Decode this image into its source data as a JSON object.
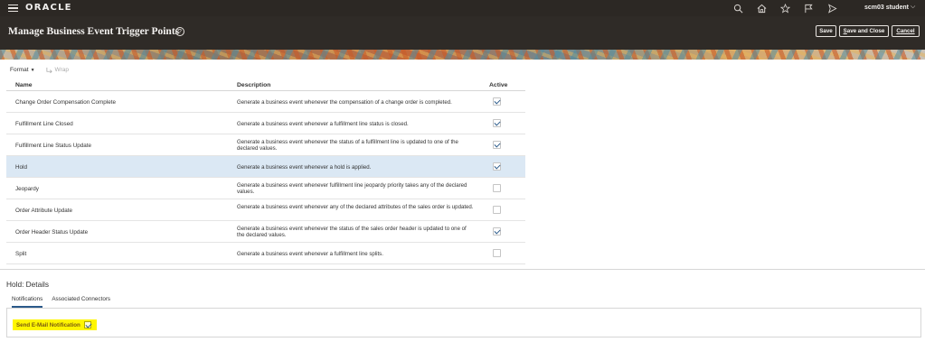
{
  "app": {
    "logo": "ORACLE",
    "user": "scm03 student",
    "user_caret": "⌵"
  },
  "header": {
    "title": "Manage Business Event Trigger Points",
    "help": "?",
    "save_label": "Save",
    "save_close_label_first": "S",
    "save_close_label_rest": "ave and Close",
    "cancel_label_first": "C",
    "cancel_label_rest": "ancel"
  },
  "toolbar": {
    "format_label": "Format",
    "format_caret": "▼",
    "wrap_label": "Wrap"
  },
  "table": {
    "columns": [
      "Name",
      "Description",
      "Active"
    ],
    "rows": [
      {
        "name": "Change Order Compensation Complete",
        "description": "Generate a business event whenever the compensation of a change order is completed.",
        "active": true,
        "selected": false
      },
      {
        "name": "Fulfillment Line Closed",
        "description": "Generate a business event whenever a fulfillment line status is closed.",
        "active": true,
        "selected": false
      },
      {
        "name": "Fulfillment Line Status Update",
        "description": "Generate a business event whenever the status of a fulfillment line is updated to one of the declared values.",
        "active": true,
        "selected": false
      },
      {
        "name": "Hold",
        "description": "Generate a business event whenever a hold is applied.",
        "active": true,
        "selected": true
      },
      {
        "name": "Jeopardy",
        "description": "Generate a business event whenever fulfillment line jeopardy priority takes any of the declared values.",
        "active": false,
        "selected": false
      },
      {
        "name": "Order Attribute Update",
        "description": "Generate a business event whenever any of the declared attributes of the sales order is updated.",
        "active": false,
        "selected": false
      },
      {
        "name": "Order Header Status Update",
        "description": "Generate a business event whenever the status of the sales order header is updated to one of the declared values.",
        "active": true,
        "selected": false
      },
      {
        "name": "Split",
        "description": "Generate a business event whenever a fulfillment line splits.",
        "active": false,
        "selected": false
      }
    ]
  },
  "details": {
    "title": "Hold: Details",
    "tabs": [
      "Notifications",
      "Associated Connectors"
    ],
    "active_tab": "Notifications",
    "email_label": "Send E-Mail Notification",
    "email_checked": true
  },
  "colors": {
    "topbar": "#2c2824",
    "selected_row": "#dbe8f4",
    "highlight": "#fff600"
  }
}
